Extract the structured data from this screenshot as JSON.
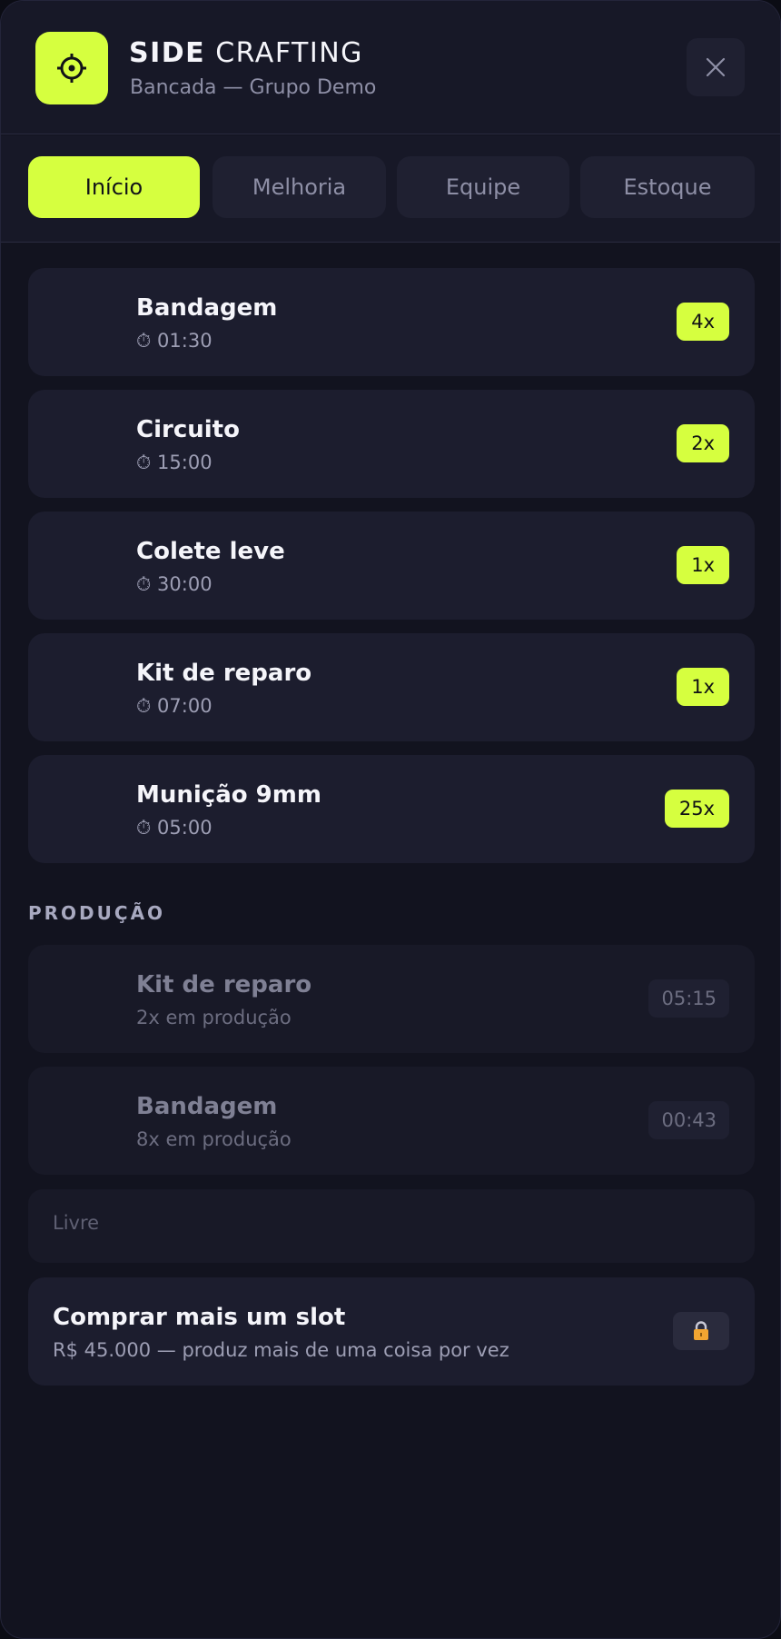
{
  "app": {
    "brand_strong": "SIDE",
    "brand_light": "CRAFTING",
    "subtitle": "Bancada — Grupo Demo",
    "logo_icon": "gear-target-icon",
    "accent_color": "#d6ff3f"
  },
  "tabs": [
    {
      "label": "Início",
      "active": true
    },
    {
      "label": "Melhoria",
      "active": false
    },
    {
      "label": "Equipe",
      "active": false
    },
    {
      "label": "Estoque",
      "active": false
    }
  ],
  "recipes": [
    {
      "name": "Bandagem",
      "time": "⏱ 01:30",
      "qty": "4x"
    },
    {
      "name": "Circuito",
      "time": "⏱ 15:00",
      "qty": "2x"
    },
    {
      "name": "Colete leve",
      "time": "⏱ 30:00",
      "qty": "1x"
    },
    {
      "name": "Kit de reparo",
      "time": "⏱ 07:00",
      "qty": "1x"
    },
    {
      "name": "Munição 9mm",
      "time": "⏱ 05:00",
      "qty": "25x"
    }
  ],
  "production": {
    "section_label": "PRODUÇÃO",
    "items": [
      {
        "name": "Kit de reparo",
        "status": "2x em produção",
        "remaining": "05:15"
      },
      {
        "name": "Bandagem",
        "status": "8x em produção",
        "remaining": "00:43"
      }
    ],
    "free_slot_label": "Livre",
    "buy_slot": {
      "title": "Comprar mais um slot",
      "description": "R$ 45.000 — produz mais de uma coisa por vez",
      "icon": "lock-icon"
    }
  }
}
